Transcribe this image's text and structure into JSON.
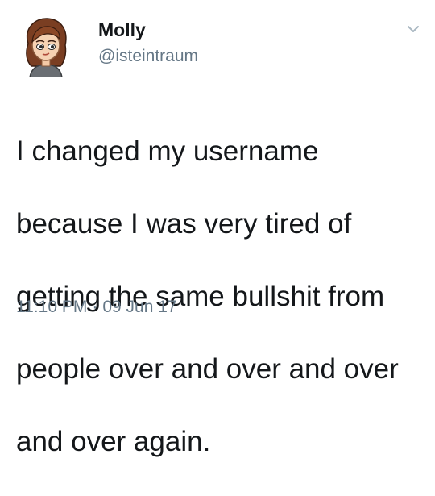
{
  "tweet": {
    "author": {
      "name": "Molly",
      "handle": "@isteintraum",
      "avatar_icon": "bitmoji-avatar-icon"
    },
    "menu_icon": "chevron-down-icon",
    "text_lines": [
      "I changed my username",
      "because I was very tired of",
      "getting the same bullshit from",
      "people over and over and over",
      "and over again."
    ],
    "time": "11:10 PM",
    "separator": "·",
    "date": "09 Jun 17"
  },
  "colors": {
    "text_primary": "#14171a",
    "text_secondary": "#657786",
    "background": "#ffffff"
  }
}
